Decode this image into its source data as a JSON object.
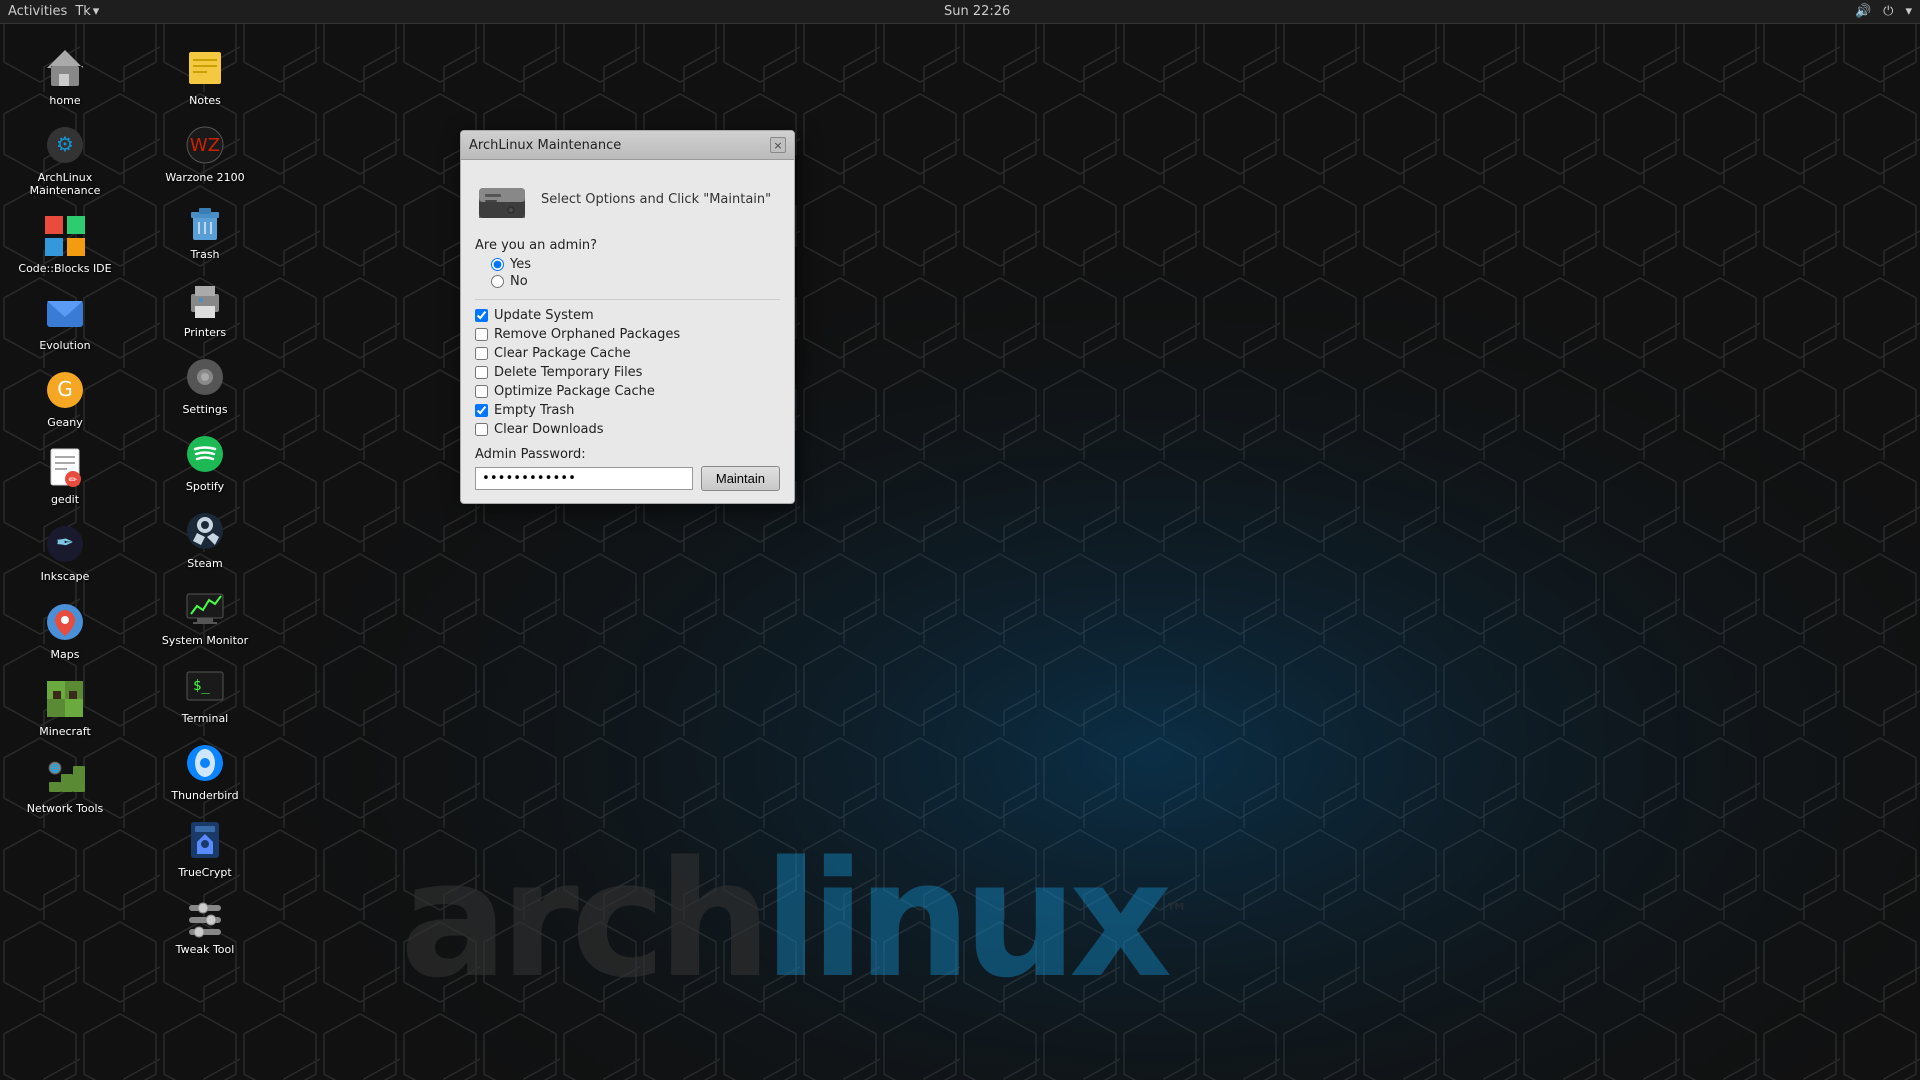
{
  "topbar": {
    "activities": "Activities",
    "appname": "Tk",
    "datetime": "Sun 22:26"
  },
  "desktop": {
    "icons_left": [
      {
        "id": "home",
        "label": "home",
        "icon": "🏠"
      },
      {
        "id": "archlinux-maintenance",
        "label": "ArchLinux\nMaintenance",
        "icon": "🛠"
      },
      {
        "id": "code-blocks",
        "label": "Code::Blocks IDE",
        "icon": "🟥"
      },
      {
        "id": "evolution",
        "label": "Evolution",
        "icon": "📧"
      },
      {
        "id": "geany",
        "label": "Geany",
        "icon": "🦣"
      },
      {
        "id": "gedit",
        "label": "gedit",
        "icon": "📝"
      },
      {
        "id": "inkscape",
        "label": "Inkscape",
        "icon": "🖋"
      },
      {
        "id": "maps",
        "label": "Maps",
        "icon": "📍"
      },
      {
        "id": "minecraft",
        "label": "Minecraft",
        "icon": "🟩"
      },
      {
        "id": "network-tools",
        "label": "Network Tools",
        "icon": "🌐"
      }
    ],
    "icons_right": [
      {
        "id": "notes",
        "label": "Notes",
        "icon": "📒"
      },
      {
        "id": "warzone",
        "label": "Warzone 2100",
        "icon": "🎮"
      },
      {
        "id": "trash",
        "label": "Trash",
        "icon": "🗑"
      },
      {
        "id": "printers",
        "label": "Printers",
        "icon": "🖨"
      },
      {
        "id": "settings",
        "label": "Settings",
        "icon": "⚙"
      },
      {
        "id": "spotify",
        "label": "Spotify",
        "icon": "🎵"
      },
      {
        "id": "steam",
        "label": "Steam",
        "icon": "💠"
      },
      {
        "id": "system-monitor",
        "label": "System Monitor",
        "icon": "📊"
      },
      {
        "id": "terminal",
        "label": "Terminal",
        "icon": "💻"
      },
      {
        "id": "thunderbird",
        "label": "Thunderbird",
        "icon": "📬"
      },
      {
        "id": "truecrypt",
        "label": "TrueCrypt",
        "icon": "🔐"
      },
      {
        "id": "tweak-tool",
        "label": "Tweak Tool",
        "icon": "🔧"
      }
    ]
  },
  "modal": {
    "title": "ArchLinux Maintenance",
    "subtitle": "Select Options and Click \"Maintain\"",
    "close_btn": "×",
    "admin_question": "Are you an admin?",
    "radio_yes": "Yes",
    "radio_no": "No",
    "checkboxes": [
      {
        "id": "update-system",
        "label": "Update System",
        "checked": true
      },
      {
        "id": "remove-orphaned",
        "label": "Remove Orphaned Packages",
        "checked": false
      },
      {
        "id": "clear-package-cache",
        "label": "Clear Package Cache",
        "checked": false
      },
      {
        "id": "delete-temp",
        "label": "Delete Temporary Files",
        "checked": false
      },
      {
        "id": "optimize-package-cache",
        "label": "Optimize Package Cache",
        "checked": false
      },
      {
        "id": "empty-trash",
        "label": "Empty Trash",
        "checked": true
      },
      {
        "id": "clear-downloads",
        "label": "Clear Downloads",
        "checked": false
      }
    ],
    "password_label": "Admin Password:",
    "password_value": "••••••••••••",
    "maintain_btn": "Maintain"
  },
  "watermark": {
    "text_gray": "arch",
    "text_blue": "linux",
    "tm": "™"
  }
}
